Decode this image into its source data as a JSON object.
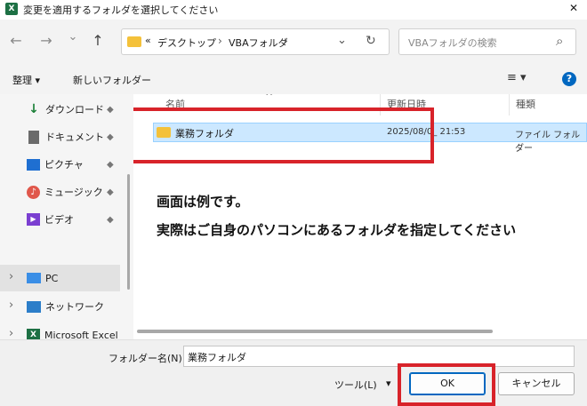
{
  "window": {
    "title": "変更を適用するフォルダを選択してください",
    "app_icon": "excel-icon",
    "close_glyph": "✕"
  },
  "nav": {
    "back_glyph": "←",
    "forward_glyph": "→",
    "recent_glyph": "⌄",
    "up_glyph": "↑",
    "breadcrumb_prefix": "«",
    "breadcrumb": [
      "デスクトップ",
      "VBAフォルダ"
    ],
    "separator": "›",
    "dropdown_glyph": "⌄",
    "refresh_glyph": "↻",
    "search_placeholder": "VBAフォルダの検索",
    "search_glyph": "⌕"
  },
  "command_bar": {
    "organize_label": "整理 ▾",
    "new_folder_label": "新しいフォルダー",
    "view_glyph": "≡ ▾",
    "help_glyph": "?"
  },
  "sidebar": {
    "quick_items": [
      {
        "label": "ダウンロード",
        "icon": "download-icon",
        "color": "#1a7f37"
      },
      {
        "label": "ドキュメント",
        "icon": "document-icon",
        "color": "#6b6b6b"
      },
      {
        "label": "ピクチャ",
        "icon": "picture-icon",
        "color": "#1f6fd1"
      },
      {
        "label": "ミュージック",
        "icon": "music-icon",
        "color": "#e0574b"
      },
      {
        "label": "ビデオ",
        "icon": "video-icon",
        "color": "#7b3fd1"
      }
    ],
    "pin_glyph": "📌",
    "tree_items": [
      {
        "label": "PC",
        "icon": "pc-icon",
        "selected": true
      },
      {
        "label": "ネットワーク",
        "icon": "network-icon",
        "selected": false
      },
      {
        "label": "Microsoft Excel",
        "icon": "excel-icon",
        "selected": false
      }
    ],
    "expand_glyph": "›"
  },
  "file_list": {
    "columns": [
      "名前",
      "更新日時",
      "種類"
    ],
    "rows": [
      {
        "name": "業務フォルダ",
        "date": "2025/08/0_ 21:53",
        "type": "ファイル フォルダー"
      }
    ]
  },
  "annotation": {
    "line1": "画面は例です。",
    "line2": "実際はご自身のパソコンにあるフォルダを指定してください"
  },
  "footer": {
    "folder_name_label": "フォルダー名(N):",
    "folder_name_value": "業務フォルダ",
    "tools_label": "ツール(L)",
    "tools_glyph": "▾",
    "ok_label": "OK",
    "cancel_label": "キャンセル"
  },
  "colors": {
    "highlight_red": "#d8232a",
    "selection_blue": "#cce8ff",
    "folder_yellow": "#f4c13a",
    "help_blue": "#0067c0"
  }
}
